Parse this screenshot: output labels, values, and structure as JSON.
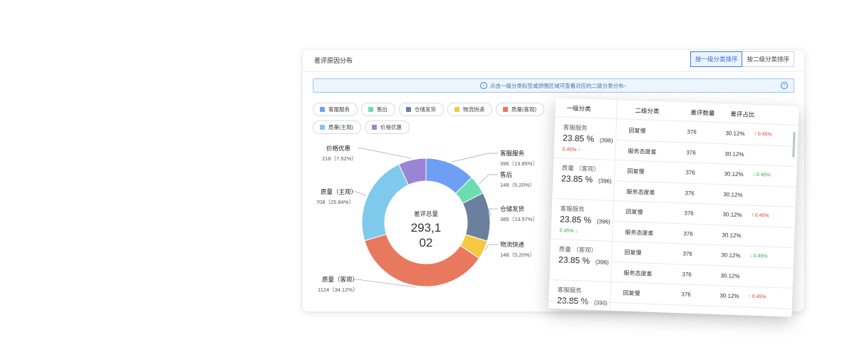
{
  "card": {
    "title": "差评原因分布",
    "sort_level1_label": "按一级分类排序",
    "sort_level2_label": "按二级分类排序",
    "notice_text": "点击一级分类标签或饼图区域可查看对应的二级分类分布~"
  },
  "legend": [
    {
      "label": "客服服务",
      "color": "#6f9ef5"
    },
    {
      "label": "售后",
      "color": "#6bdeb0"
    },
    {
      "label": "仓储发货",
      "color": "#6b7f9e"
    },
    {
      "label": "物流快递",
      "color": "#f5c842"
    },
    {
      "label": "质量(客观)",
      "color": "#e9795e"
    },
    {
      "label": "质量(主观)",
      "color": "#7fc9ec"
    },
    {
      "label": "价格优惠",
      "color": "#9a84d6"
    }
  ],
  "donut": {
    "center_label": "差评总量",
    "center_value_line1": "293,1",
    "center_value_line2": "02"
  },
  "chart_data": {
    "type": "pie",
    "title": "差评原因分布",
    "slices": [
      {
        "name": "客服服务",
        "value": 396,
        "percent": "13.85%",
        "color": "#6f9ef5"
      },
      {
        "name": "售后",
        "value": 148,
        "percent": "5.20%",
        "color": "#6bdeb0"
      },
      {
        "name": "仓储发货",
        "value": 385,
        "percent": "13.57%",
        "color": "#6b7f9e"
      },
      {
        "name": "物流快递",
        "value": 148,
        "percent": "5.20%",
        "color": "#f5c842"
      },
      {
        "name": "质量（客观）",
        "value": 1124,
        "percent": "34.12%",
        "color": "#e9795e"
      },
      {
        "name": "质量（主观）",
        "value": 708,
        "percent": "25.84%",
        "color": "#7fc9ec"
      },
      {
        "name": "价格优惠",
        "value": 218,
        "percent": "7.52%",
        "color": "#9a84d6"
      }
    ]
  },
  "table": {
    "headers": [
      "一级分类",
      "二级分类",
      "差评数量",
      "差评占比"
    ],
    "groups": [
      {
        "name": "客服服务",
        "pct": "23.85 %",
        "count": "(396)",
        "change": "0.45%",
        "dir": "up",
        "rows": [
          {
            "sub": "回复慢",
            "num": "376",
            "ratio": "30.12%",
            "change": "0.45%",
            "dir": "up"
          },
          {
            "sub": "服务态度差",
            "num": "376",
            "ratio": "30.12%",
            "change": "",
            "dir": ""
          }
        ]
      },
      {
        "name": "质量 （客观）",
        "pct": "23.85 %",
        "count": "(396)",
        "change": "",
        "dir": "",
        "rows": [
          {
            "sub": "回复慢",
            "num": "376",
            "ratio": "30.12%",
            "change": "0.45%",
            "dir": "down"
          },
          {
            "sub": "服务态度差",
            "num": "376",
            "ratio": "30.12%",
            "change": "",
            "dir": ""
          }
        ]
      },
      {
        "name": "客服服务",
        "pct": "23.85 %",
        "count": "(396)",
        "change": "0.45%",
        "dir": "down",
        "rows": [
          {
            "sub": "回复慢",
            "num": "376",
            "ratio": "30.12%",
            "change": "0.45%",
            "dir": "up"
          },
          {
            "sub": "服务态度差",
            "num": "376",
            "ratio": "30.12%",
            "change": "",
            "dir": ""
          }
        ]
      },
      {
        "name": "质量 （客观）",
        "pct": "23.85 %",
        "count": "(396)",
        "change": "",
        "dir": "",
        "rows": [
          {
            "sub": "回复慢",
            "num": "376",
            "ratio": "30.12%",
            "change": "0.45%",
            "dir": "down"
          },
          {
            "sub": "服务态度差",
            "num": "376",
            "ratio": "30.12%",
            "change": "",
            "dir": ""
          }
        ]
      },
      {
        "name": "客服服务",
        "pct": "23.85 %",
        "count": "(396)",
        "change": "",
        "dir": "",
        "rows": [
          {
            "sub": "回复慢",
            "num": "376",
            "ratio": "30.12%",
            "change": "0.45%",
            "dir": "up"
          }
        ]
      }
    ]
  }
}
